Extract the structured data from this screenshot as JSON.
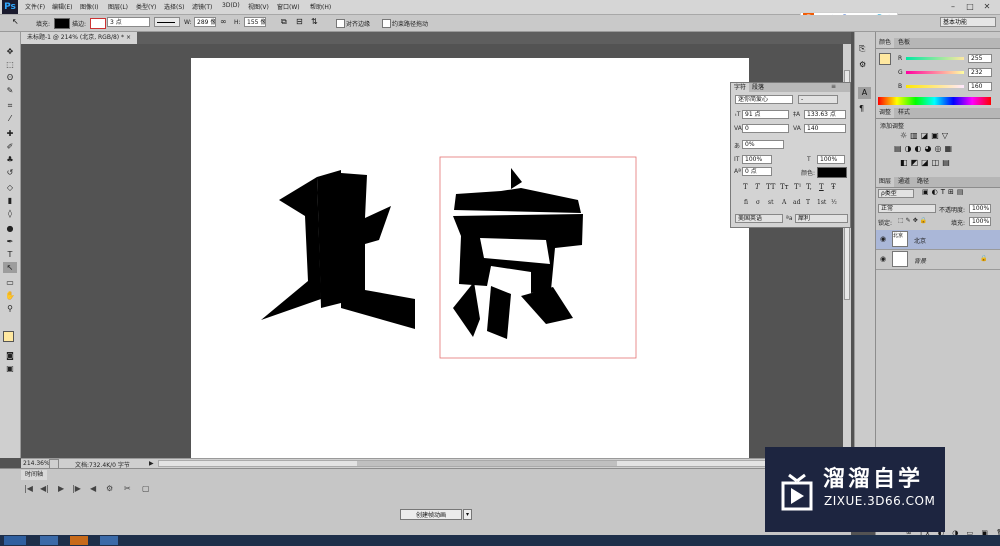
{
  "app": {
    "logo": "Ps",
    "menus": [
      "文件(F)",
      "编辑(E)",
      "图像(I)",
      "图层(L)",
      "类型(Y)",
      "选择(S)",
      "滤镜(T)",
      "3D(D)",
      "视图(V)",
      "窗口(W)",
      "帮助(H)"
    ],
    "window_controls": [
      "–",
      "□",
      "✕"
    ]
  },
  "options_bar": {
    "fill_label": "填充:",
    "stroke_label": "描边:",
    "stroke_width": "3 点",
    "w_label": "W:",
    "w_value": "289 像",
    "h_label": "H:",
    "h_value": "155 像",
    "align_edges": "对齐边缘",
    "constrain_path": "约束路径拖动",
    "workspace": "基本功能"
  },
  "sogou_bar": {
    "items": [
      "S",
      "中",
      "♪",
      "☺",
      "⌨",
      "▣",
      "👕",
      "⚙"
    ]
  },
  "document": {
    "tab_title": "未标题-1 @ 214% (北京, RGB/8) *",
    "zoom": "214.36%",
    "doc_size": "文档:732.4K/0 字节",
    "text_layer": "北京"
  },
  "timeline": {
    "tab": "时间轴",
    "create_button": "创建帧动画",
    "controls": [
      "|◀",
      "◀|",
      "▶",
      "|▶",
      "◀",
      "⚙",
      "✂",
      "▢"
    ]
  },
  "character_panel": {
    "tabs": [
      "字符",
      "段落"
    ],
    "font_family": "迷你简爱心",
    "font_style": "-",
    "font_size": "91 点",
    "leading": "133.63 点",
    "kerning": "0",
    "tracking": "140",
    "tsume": "0%",
    "vertical_scale": "100%",
    "horizontal_scale": "100%",
    "baseline_shift": "0 点",
    "color_label": "颜色:",
    "language": "美国英语",
    "aa_label": "ªa",
    "antialias": "犀利",
    "style_buttons": [
      "T",
      "T",
      "TT",
      "Tт",
      "T¹",
      "T,",
      "T",
      "Ŧ"
    ],
    "feature_buttons": [
      "fi",
      "σ",
      "st",
      "A",
      "ad",
      "T",
      "1st",
      "½"
    ]
  },
  "color_panel": {
    "tabs": [
      "颜色",
      "色板"
    ],
    "r_label": "R",
    "g_label": "G",
    "b_label": "B",
    "r": "255",
    "g": "232",
    "b": "160",
    "fg_color": "#ffe8a0"
  },
  "adjust_panel": {
    "tabs": [
      "调整",
      "样式"
    ],
    "title": "添加调整"
  },
  "layers_panel": {
    "tabs": [
      "图层",
      "通道",
      "路径"
    ],
    "filter_kind": "ρ类型",
    "blend_mode": "正常",
    "opacity_label": "不透明度:",
    "opacity": "100%",
    "lock_label": "锁定:",
    "fill_label": "填充:",
    "fill": "100%",
    "layers": [
      {
        "name": "北京",
        "thumb": "北京"
      },
      {
        "name": "背景",
        "thumb": ""
      }
    ]
  },
  "watermark": {
    "cn": "溜溜自学",
    "en": "ZIXUE.3D66.COM"
  }
}
